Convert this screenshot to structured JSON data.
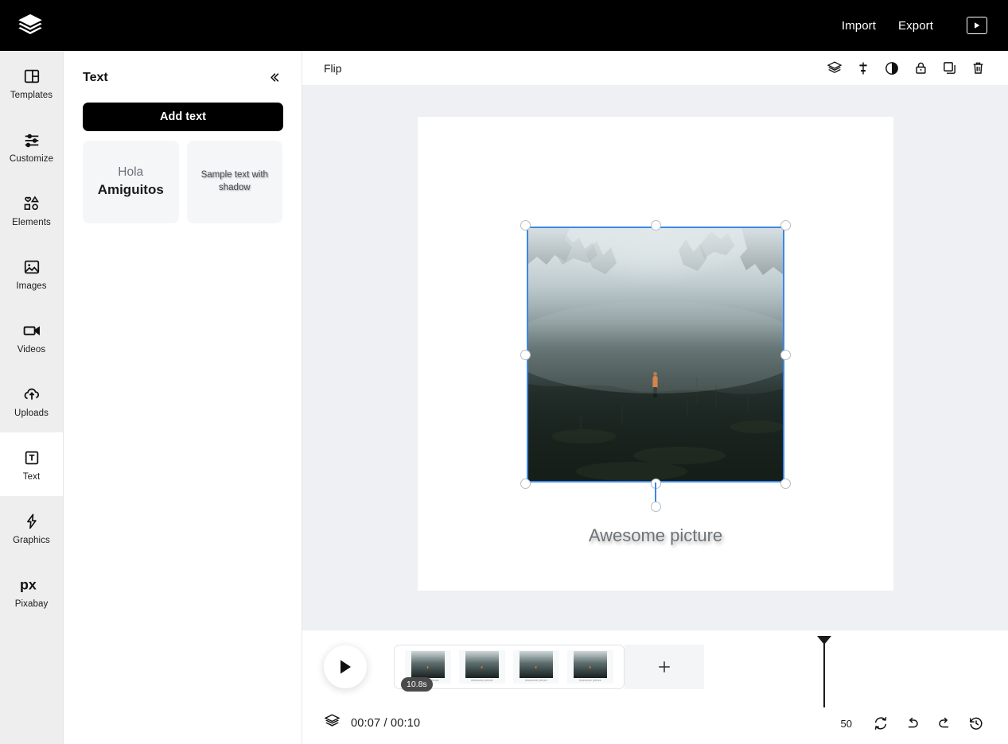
{
  "app": {
    "logo_icon": "layers-stack-logo",
    "header": {
      "import_label": "Import",
      "export_label": "Export",
      "preview_icon": "play-in-box-icon"
    }
  },
  "sidebar": {
    "items": [
      {
        "label": "Templates",
        "icon": "templates-layout-icon",
        "active": false
      },
      {
        "label": "Customize",
        "icon": "sliders-icon",
        "active": false
      },
      {
        "label": "Elements",
        "icon": "shapes-icon",
        "active": false
      },
      {
        "label": "Images",
        "icon": "image-icon",
        "active": false
      },
      {
        "label": "Videos",
        "icon": "video-camera-icon",
        "active": false
      },
      {
        "label": "Uploads",
        "icon": "cloud-upload-icon",
        "active": false
      },
      {
        "label": "Text",
        "icon": "text-box-t-icon",
        "active": true
      },
      {
        "label": "Graphics",
        "icon": "lightning-bolt-icon",
        "active": false
      },
      {
        "label": "Pixabay",
        "icon": "pixabay-px-icon",
        "active": false
      }
    ]
  },
  "panel": {
    "title": "Text",
    "collapse_icon": "double-chevron-left-icon",
    "add_text_label": "Add text",
    "presets": [
      {
        "line1": "Hola",
        "line2": "Amiguitos",
        "style": "two-line"
      },
      {
        "line1": "Sample text with shadow",
        "line2": "",
        "style": "shadow"
      }
    ]
  },
  "context_bar": {
    "label": "Flip",
    "tools": [
      {
        "name": "layers-icon",
        "title": "Layers"
      },
      {
        "name": "align-icon",
        "title": "Position"
      },
      {
        "name": "contrast-icon",
        "title": "Opacity"
      },
      {
        "name": "lock-icon",
        "title": "Lock"
      },
      {
        "name": "duplicate-icon",
        "title": "Duplicate"
      },
      {
        "name": "trash-icon",
        "title": "Delete"
      }
    ]
  },
  "canvas": {
    "selected_object": "photo",
    "selection_color": "#3c87e8",
    "caption_text": "Awesome picture",
    "caption_color": "#6d7378"
  },
  "timeline": {
    "play_icon": "play-icon",
    "clip_duration_badge": "10.8s",
    "add_clip_icon": "plus-icon",
    "clips": [
      {
        "caption": "Awesome picture"
      },
      {
        "caption": "Awesome picture"
      },
      {
        "caption": "Awesome picture"
      },
      {
        "caption": "Awesome picture"
      }
    ]
  },
  "statusbar": {
    "layers_icon": "layers-icon",
    "time_display": "00:07 / 00:10",
    "zoom_value": "50",
    "controls": [
      {
        "name": "loop-icon",
        "title": "Loop"
      },
      {
        "name": "undo-icon",
        "title": "Undo"
      },
      {
        "name": "redo-icon",
        "title": "Redo"
      },
      {
        "name": "history-icon",
        "title": "History"
      }
    ]
  }
}
